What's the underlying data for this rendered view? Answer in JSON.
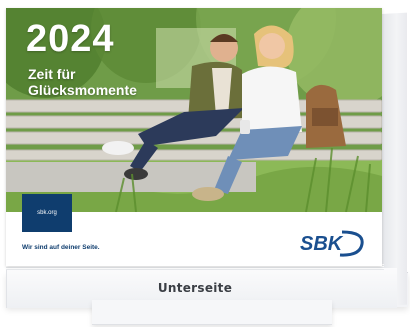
{
  "cover": {
    "year": "2024",
    "tagline_lines": [
      "Zeit für",
      "Glücksmomente"
    ],
    "url_badge": "sbk.org",
    "slogan": "Wir sind auf deiner Seite.",
    "logo_text": "SBK"
  },
  "base": {
    "label": "Unterseite"
  },
  "colors": {
    "brand_blue": "#0f3d6e",
    "logo_blue": "#1a4f8f",
    "text_white": "#ffffff"
  }
}
